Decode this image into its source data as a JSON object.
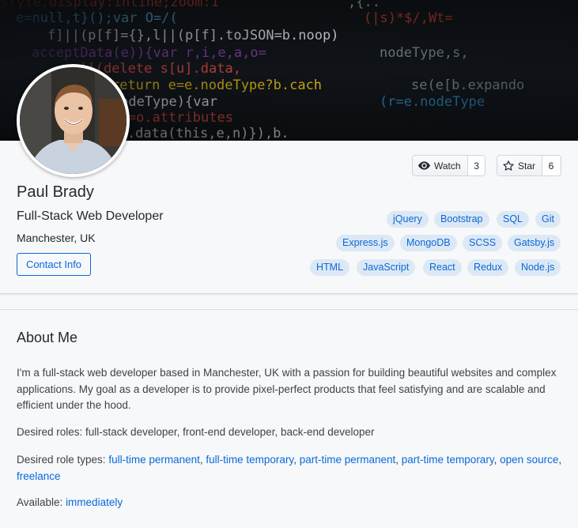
{
  "profile": {
    "name": "Paul Brady",
    "role": "Full-Stack Web Developer",
    "location": "Manchester, UK",
    "contact_label": "Contact Info"
  },
  "github": {
    "watch_label": "Watch",
    "watch_count": "3",
    "star_label": "Star",
    "star_count": "6"
  },
  "skills": [
    "jQuery",
    "Bootstrap",
    "SQL",
    "Git",
    "Express.js",
    "MongoDB",
    "SCSS",
    "Gatsby.js",
    "HTML",
    "JavaScript",
    "React",
    "Redux",
    "Node.js"
  ],
  "about": {
    "title": "About Me",
    "intro": "I'm a full-stack web developer based in Manchester, UK with a passion for building beautiful websites and complex applications. My goal as a developer is to provide pixel-perfect products that feel satisfying and are scalable and efficient under the hood.",
    "desired_roles_label": "Desired roles:",
    "desired_roles": "full-stack developer, front-end developer, back-end developer",
    "role_types_label": "Desired role types:",
    "role_types": [
      "full-time permanent",
      "full-time temporary",
      "part-time permanent",
      "part-time temporary",
      "open source",
      "freelance"
    ],
    "available_label": "Available:",
    "available_value": "immediately"
  },
  "colors": {
    "accent": "#0969da",
    "tag_bg": "#dde8f5",
    "page_bg": "#f6f8fa"
  },
  "icons": {
    "watch": "eye-icon",
    "star": "star-icon"
  }
}
